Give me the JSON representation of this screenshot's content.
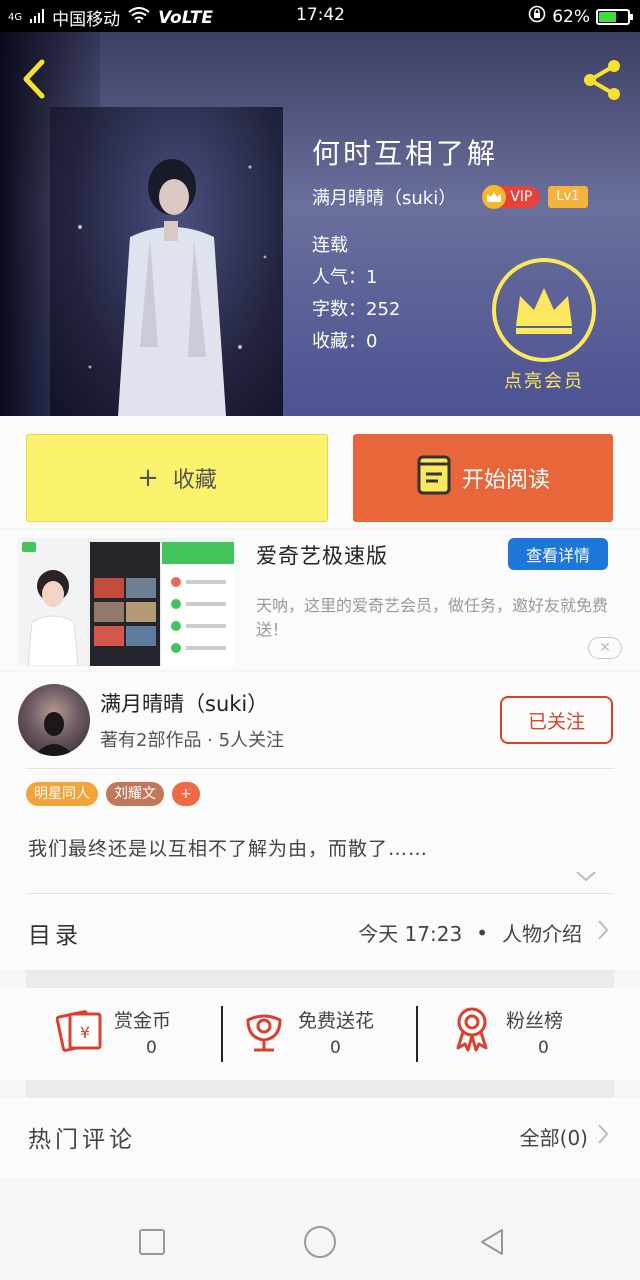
{
  "status_bar": {
    "carrier": "中国移动",
    "network": "VoLTE",
    "signal": "4G",
    "time": "17:42",
    "battery": "62%",
    "battery_level": 0.62
  },
  "book": {
    "title": "何时互相了解",
    "author": "满月晴晴（suki）",
    "vip_label": "VIP",
    "level": "Lv1",
    "status": "连载",
    "popularity": "人气：1",
    "word_count": "字数：252",
    "favorites": "收藏：0",
    "member_button": "点亮会员"
  },
  "actions": {
    "favorite": "收藏",
    "favorite_plus": "+",
    "read": "开始阅读"
  },
  "ad": {
    "title": "爱奇艺极速版",
    "detail_button": "查看详情",
    "description": "天呐，这里的爱奇艺会员，做任务，邀好友就免费送！",
    "close": "✕"
  },
  "author_card": {
    "name": "满月晴晴（suki）",
    "meta": "著有2部作品 · 5人关注",
    "follow_button": "已关注"
  },
  "tags": [
    {
      "label": "明星同人",
      "color": "#f2a33a"
    },
    {
      "label": "刘耀文",
      "color": "#c0775a"
    },
    {
      "label": "+",
      "color": "#ee6a45"
    }
  ],
  "summary": "我们最终还是以互相不了解为由，而散了……",
  "catalog": {
    "label": "目录",
    "updated": "今天 17:23",
    "dot": "•",
    "chapter": "人物介绍"
  },
  "stats": [
    {
      "label": "赏金币",
      "value": "0",
      "icon": "red-envelope-icon"
    },
    {
      "label": "免费送花",
      "value": "0",
      "icon": "flower-icon"
    },
    {
      "label": "粉丝榜",
      "value": "0",
      "icon": "medal-icon"
    }
  ],
  "comments": {
    "label": "热门评论",
    "all": "全部(0)"
  },
  "colors": {
    "accent_orange": "#e9663a",
    "favorite_yellow": "#fbf36e",
    "vip_red": "#e6413a",
    "member_gold": "#fbe85c",
    "follow_red": "#d8412d",
    "ad_blue": "#1f76d9"
  }
}
